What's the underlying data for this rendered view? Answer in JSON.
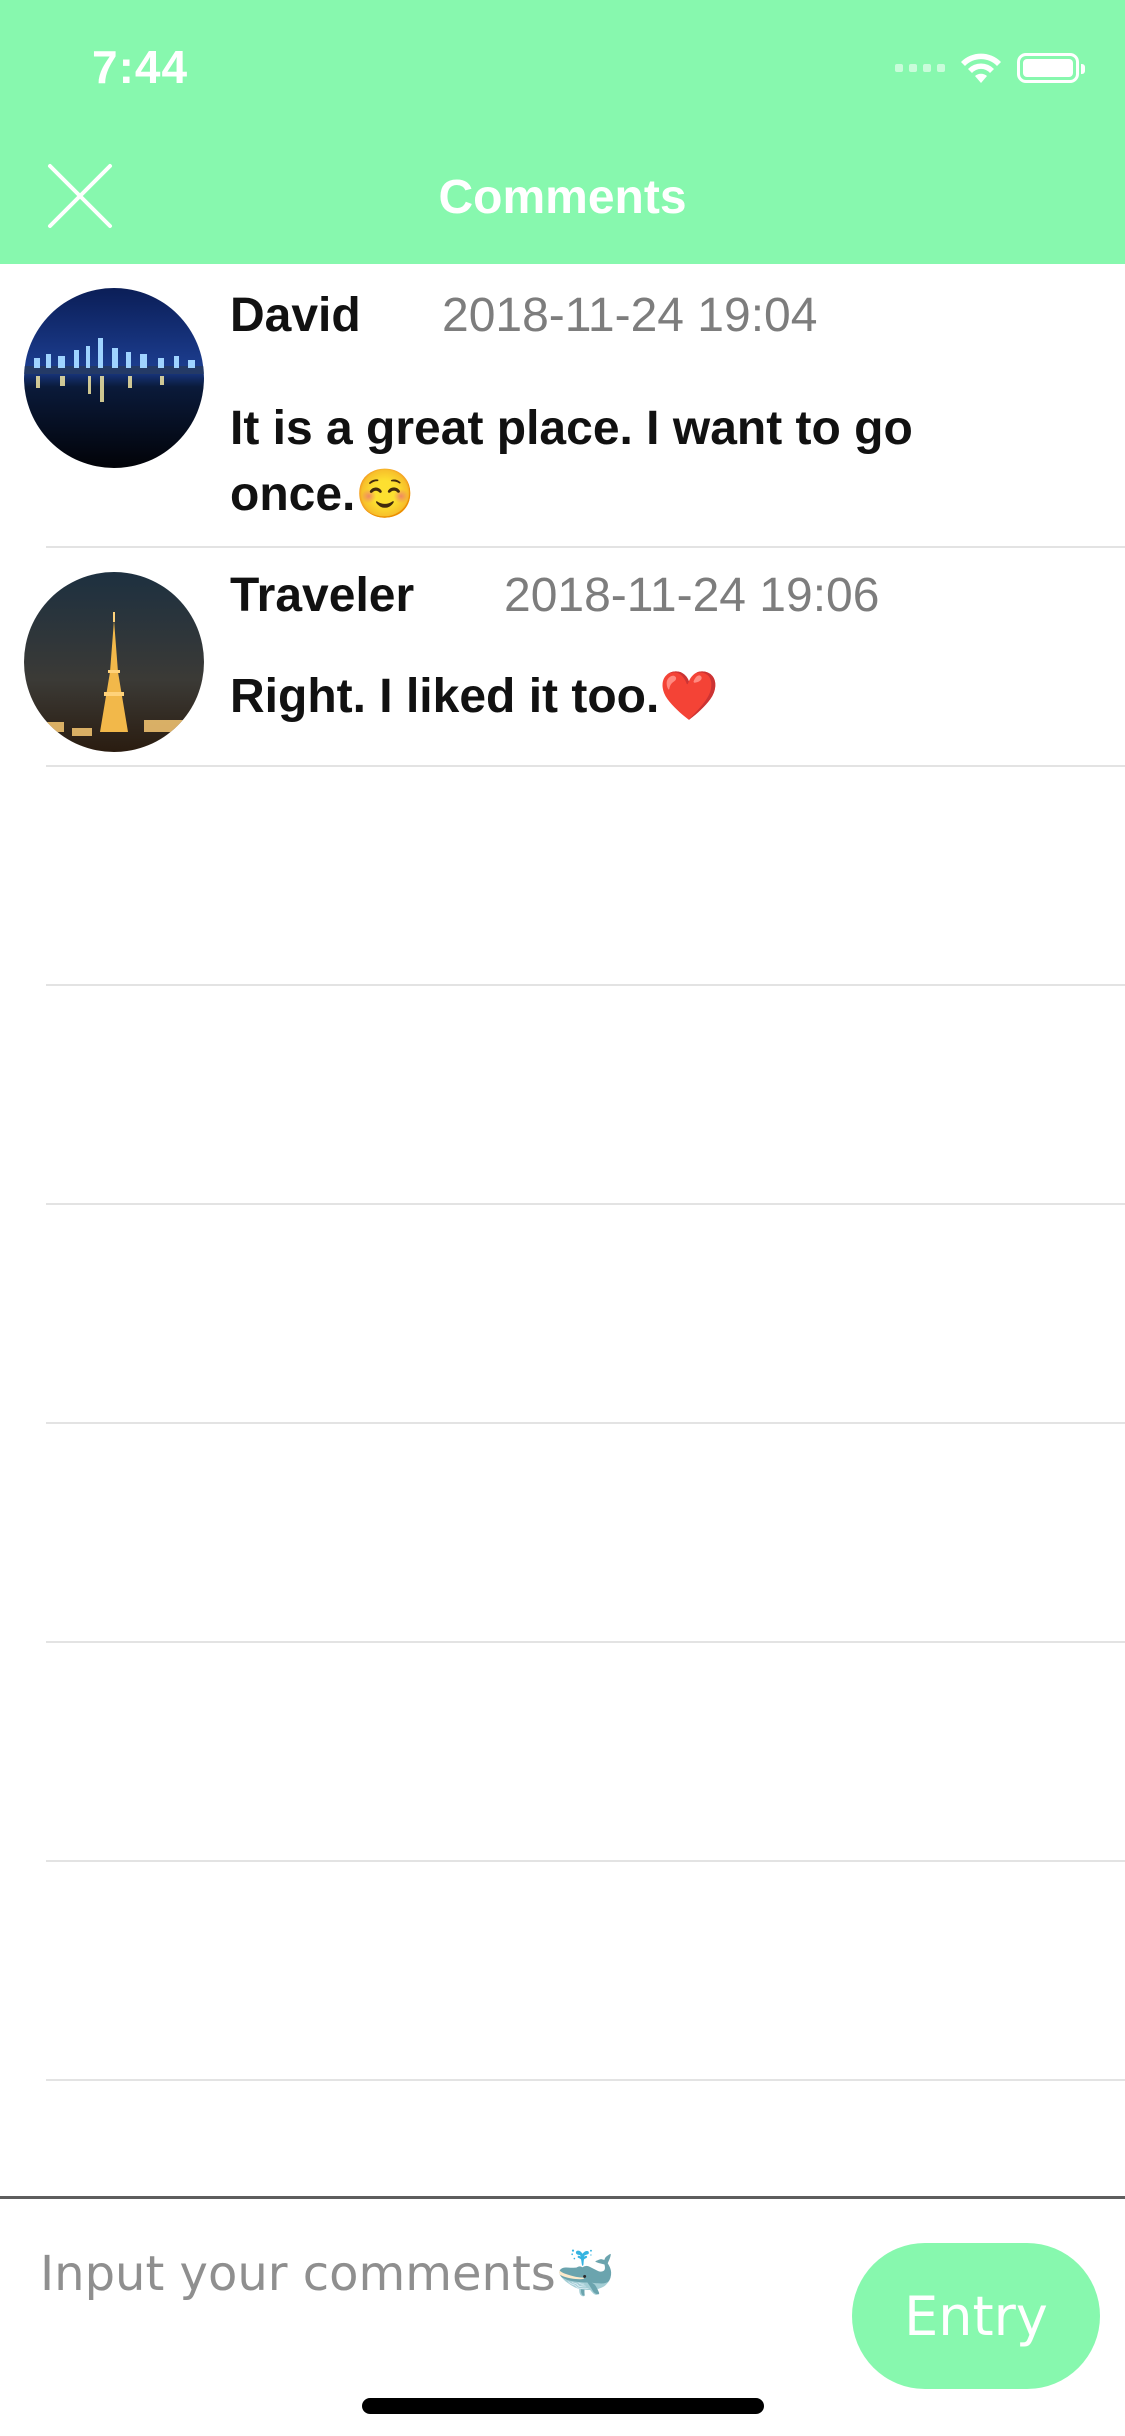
{
  "status_bar": {
    "time": "7:44"
  },
  "header": {
    "title": "Comments",
    "close_icon": "close-icon"
  },
  "comments": [
    {
      "author": "David",
      "timestamp": "2018-11-24 19:04",
      "text": "It is a great place. I want to go once.☺️",
      "avatar": "city-skyline-night"
    },
    {
      "author": "Traveler",
      "timestamp": "2018-11-24 19:06",
      "text": "Right. I liked it too.❤️",
      "avatar": "eiffel-tower-night"
    }
  ],
  "input_bar": {
    "placeholder": "Input your comments🐳",
    "value": "",
    "entry_label": "Entry"
  },
  "colors": {
    "accent": "#87f8ae",
    "timestamp": "#7d7d7d",
    "divider": "#e3e3e3"
  }
}
